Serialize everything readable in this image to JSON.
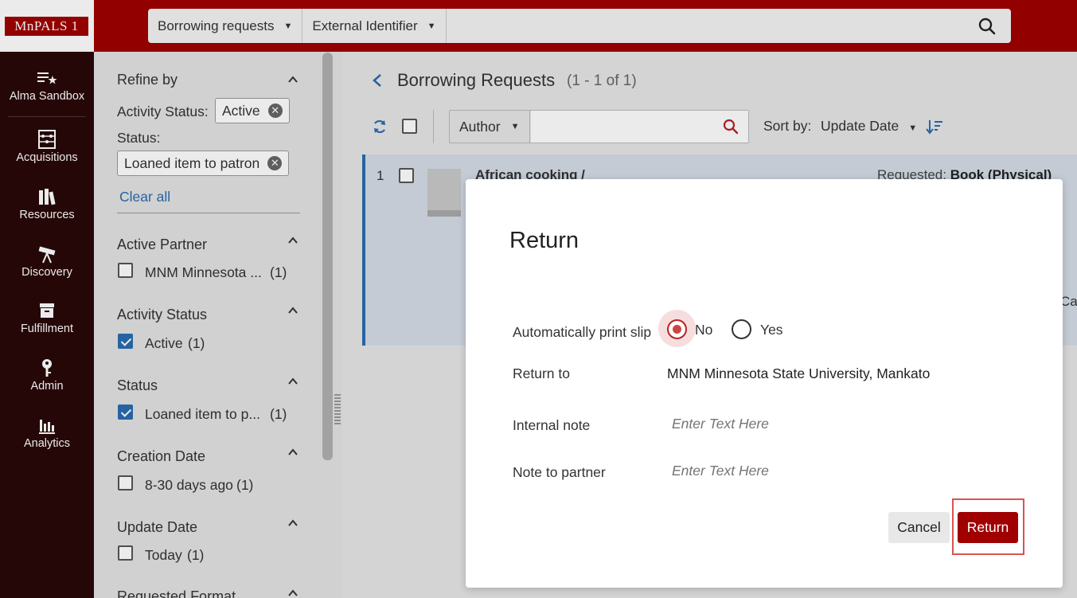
{
  "brand": {
    "logo_text": "MnPALS 1",
    "accent": "#a00000"
  },
  "search": {
    "scope_label": "Borrowing requests",
    "field_label": "External Identifier",
    "query": ""
  },
  "nav": {
    "items": [
      {
        "label": "Alma Sandbox",
        "icon": "list-star-icon"
      },
      {
        "label": "Acquisitions",
        "icon": "abacus-icon"
      },
      {
        "label": "Resources",
        "icon": "books-icon"
      },
      {
        "label": "Discovery",
        "icon": "telescope-icon"
      },
      {
        "label": "Fulfillment",
        "icon": "archive-box-icon"
      },
      {
        "label": "Admin",
        "icon": "key-icon"
      },
      {
        "label": "Analytics",
        "icon": "bar-chart-icon"
      }
    ]
  },
  "filters": {
    "refine_title": "Refine by",
    "activity_status_label": "Activity Status:",
    "activity_status_chip": "Active",
    "status_label": "Status:",
    "status_chip": "Loaned item to patron",
    "clear_all": "Clear all",
    "groups": [
      {
        "title": "Active Partner",
        "option": "MNM Minnesota ...",
        "count": "(1)",
        "checked": false
      },
      {
        "title": "Activity Status",
        "option": "Active",
        "count": "(1)",
        "checked": true
      },
      {
        "title": "Status",
        "option": "Loaned item to p...",
        "count": "(1)",
        "checked": true
      },
      {
        "title": "Creation Date",
        "option": "8-30 days ago",
        "count": "(1)",
        "checked": false
      },
      {
        "title": "Update Date",
        "option": "Today",
        "count": "(1)",
        "checked": false
      },
      {
        "title": "Requested Format",
        "option": "",
        "count": "",
        "checked": false
      }
    ]
  },
  "main": {
    "title": "Borrowing Requests",
    "count": "(1 - 1 of 1)",
    "filter_field": "Author",
    "filter_query": "",
    "sort_label": "Sort by:",
    "sort_value": "Update Date",
    "row": {
      "number": "1",
      "title": "African cooking /",
      "requested_label": "Requested:",
      "requested_value": "Book (Physical)",
      "trailing_text": "Ca"
    }
  },
  "dialog": {
    "title": "Return",
    "print_slip_label": "Automatically print slip",
    "option_no": "No",
    "option_yes": "Yes",
    "selected": "No",
    "return_to_label": "Return to",
    "return_to_value": "MNM Minnesota State University, Mankato",
    "internal_note_label": "Internal note",
    "internal_note_placeholder": "Enter Text Here",
    "partner_note_label": "Note to partner",
    "partner_note_placeholder": "Enter Text Here",
    "cancel_label": "Cancel",
    "return_label": "Return"
  }
}
